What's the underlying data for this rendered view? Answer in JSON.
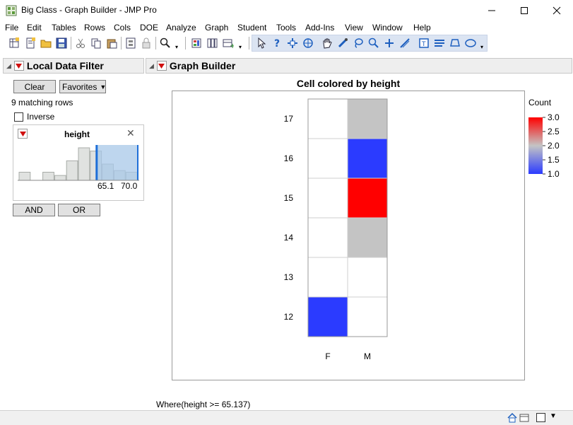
{
  "window": {
    "title": "Big Class - Graph Builder - JMP Pro"
  },
  "menu": [
    "File",
    "Edit",
    "Tables",
    "Rows",
    "Cols",
    "DOE",
    "Analyze",
    "Graph",
    "Student",
    "Tools",
    "Add-Ins",
    "View",
    "Window",
    "Help"
  ],
  "toolbar": {
    "icons": [
      "new-data-table-icon",
      "new-script-icon",
      "open-icon",
      "save-icon",
      "cut-icon",
      "copy-icon",
      "paste-icon",
      "journal-icon",
      "lock-icon",
      "search-icon",
      "report-icon",
      "tables-icon",
      "add-rows-icon",
      "arrow-tool-icon",
      "help-tool-icon",
      "crosshair-tool-icon",
      "selection-tool-icon",
      "hand-tool-icon",
      "brush-tool-icon",
      "lasso-tool-icon",
      "magnifier-tool-icon",
      "plus-tool-icon",
      "line-tool-icon",
      "annotate-tool-icon",
      "simple-shape-icon",
      "polygon-icon",
      "ellipse-icon"
    ]
  },
  "filter": {
    "title": "Local Data Filter",
    "clear_label": "Clear",
    "favorites_label": "Favorites",
    "matching_text": "9 matching rows",
    "inverse_label": "Inverse",
    "variable": "height",
    "range_low": "65.1",
    "range_high": "70.0",
    "histogram_rel_heights": [
      0.25,
      0.0,
      0.25,
      0.15,
      0.6,
      1.0,
      0.9,
      0.5,
      0.3,
      0.25
    ],
    "selected_range_fraction": [
      0.65,
      1.0
    ],
    "and_label": "AND",
    "or_label": "OR"
  },
  "graph_builder": {
    "title": "Graph Builder",
    "footer": "Where(height >= 65.137)"
  },
  "chart_data": {
    "type": "heatmap",
    "title": "Cell colored by height",
    "x_categories": [
      "F",
      "M"
    ],
    "y_categories": [
      "12",
      "13",
      "14",
      "15",
      "16",
      "17"
    ],
    "color_variable": "Count",
    "color_scale": {
      "min": 1.0,
      "max": 3.0,
      "ticks": [
        "3.0",
        "2.5",
        "2.0",
        "1.5",
        "1.0"
      ],
      "low_color": "#2b3bff",
      "mid_color": "#c4c4c4",
      "high_color": "#ff0000"
    },
    "cells": [
      {
        "x": "F",
        "y": "12",
        "count": 1
      },
      {
        "x": "F",
        "y": "13",
        "count": null
      },
      {
        "x": "F",
        "y": "14",
        "count": null
      },
      {
        "x": "F",
        "y": "15",
        "count": null
      },
      {
        "x": "F",
        "y": "16",
        "count": null
      },
      {
        "x": "F",
        "y": "17",
        "count": null
      },
      {
        "x": "M",
        "y": "12",
        "count": null
      },
      {
        "x": "M",
        "y": "13",
        "count": null
      },
      {
        "x": "M",
        "y": "14",
        "count": 2
      },
      {
        "x": "M",
        "y": "15",
        "count": 3
      },
      {
        "x": "M",
        "y": "16",
        "count": 1
      },
      {
        "x": "M",
        "y": "17",
        "count": 2
      }
    ]
  },
  "colors": {
    "accent": "#1e6fd8",
    "filter_selection": "#a8c8e8",
    "header_bg": "#eeeeee"
  }
}
